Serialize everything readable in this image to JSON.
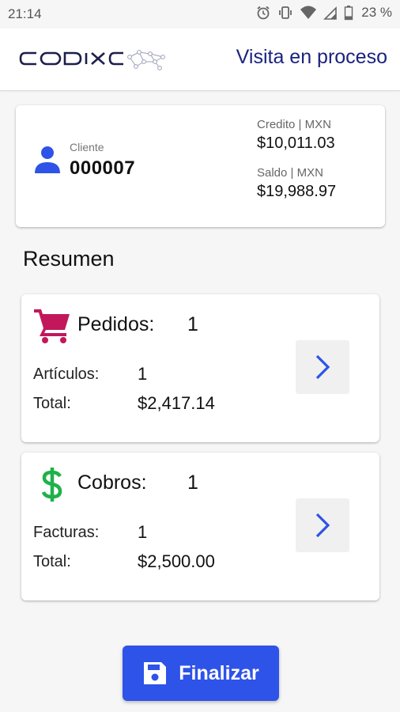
{
  "status_bar": {
    "time": "21:14",
    "battery": "23 %"
  },
  "header": {
    "logo_text": "CODI·C",
    "title": "Visita en proceso"
  },
  "client": {
    "label": "Cliente",
    "id": "000007",
    "credit_label": "Credito | MXN",
    "credit_value": "$10,011.03",
    "saldo_label": "Saldo | MXN",
    "saldo_value": "$19,988.97"
  },
  "summary": {
    "title": "Resumen",
    "pedidos": {
      "label": "Pedidos:",
      "count": "1",
      "row1_label": "Artículos:",
      "row1_value": "1",
      "row2_label": "Total:",
      "row2_value": "$2,417.14",
      "icon": "shopping-cart-icon",
      "icon_color": "#c2185b"
    },
    "cobros": {
      "label": "Cobros:",
      "count": "1",
      "row1_label": "Facturas:",
      "row1_value": "1",
      "row2_label": "Total:",
      "row2_value": "$2,500.00",
      "icon": "dollar-icon",
      "icon_color": "#1fb14a"
    }
  },
  "actions": {
    "finalize_label": "Finalizar",
    "finalize_icon": "save-icon"
  },
  "colors": {
    "accent": "#2e53e8",
    "title": "#1a237e",
    "person_icon": "#2e53e8"
  }
}
